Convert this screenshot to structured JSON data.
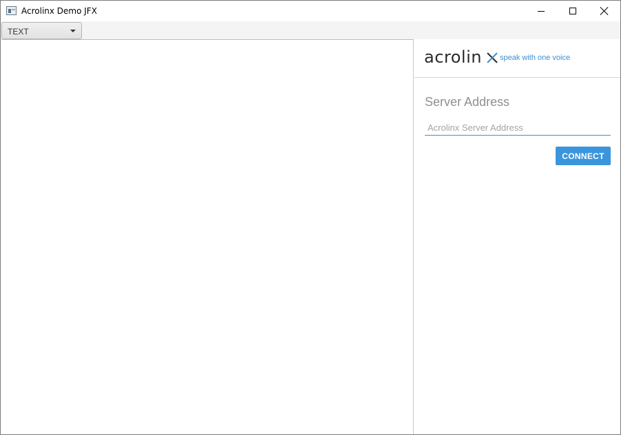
{
  "window": {
    "title": "Acrolinx Demo JFX"
  },
  "icons": {
    "app": "app-window-icon",
    "minimize": "minimize-icon",
    "maximize": "maximize-icon",
    "close": "close-icon",
    "dropdown": "chevron-down-icon",
    "logo_x": "acrolinx-x-logo-icon"
  },
  "toolbar": {
    "mode_selected": "TEXT"
  },
  "sidebar": {
    "logo_word": "acrolin",
    "tagline": "speak with one voice",
    "server_heading": "Server Address",
    "server_input_placeholder": "Acrolinx Server Address",
    "server_input_value": "",
    "connect_label": "CONNECT"
  },
  "colors": {
    "accent": "#3a95dc",
    "tagline": "#3a8fd6",
    "heading": "#8f8f8f"
  }
}
